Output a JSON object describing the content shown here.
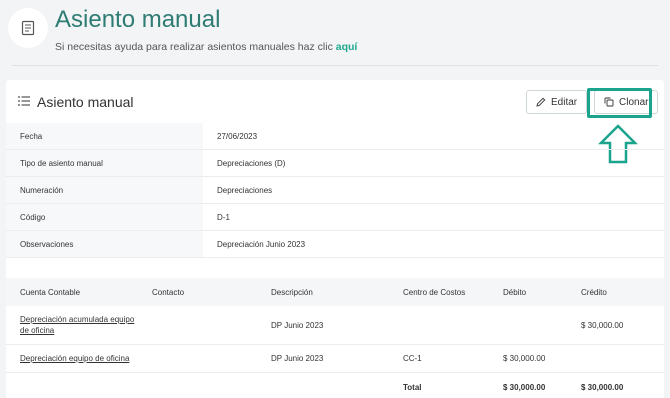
{
  "header": {
    "title": "Asiento manual",
    "help_text": "Si necesitas ayuda para realizar asientos manuales haz clic ",
    "help_link": "aquí"
  },
  "card": {
    "title": "Asiento manual",
    "edit_label": "Editar",
    "clone_label": "Clonar"
  },
  "details": [
    {
      "label": "Fecha",
      "value": "27/06/2023"
    },
    {
      "label": "Tipo de asiento manual",
      "value": "Depreciaciones (D)"
    },
    {
      "label": "Numeración",
      "value": "Depreciaciones"
    },
    {
      "label": "Código",
      "value": "D-1"
    },
    {
      "label": "Observaciones",
      "value": "Depreciación Junio 2023"
    }
  ],
  "table": {
    "headers": [
      "Cuenta Contable",
      "Contacto",
      "Descripción",
      "Centro de Costos",
      "Débito",
      "Crédito"
    ],
    "rows": [
      {
        "cuenta": "Depreciación acumulada equipo de oficina",
        "contacto": "",
        "descripcion": "DP Junio 2023",
        "centro": "",
        "debito": "",
        "credito": "$ 30,000.00"
      },
      {
        "cuenta": "Depreciación equipo de oficina",
        "contacto": "",
        "descripcion": "DP Junio 2023",
        "centro": "CC-1",
        "debito": "$ 30,000.00",
        "credito": ""
      }
    ],
    "total": {
      "label": "Total",
      "debito": "$ 30,000.00",
      "credito": "$ 30,000.00"
    }
  },
  "colors": {
    "accent": "#1aa38d",
    "title": "#2e7c73"
  },
  "icons": {
    "header": "document-icon",
    "card": "list-icon",
    "edit": "pencil-icon",
    "clone": "copy-icon",
    "annotation": "arrow-up-icon"
  }
}
